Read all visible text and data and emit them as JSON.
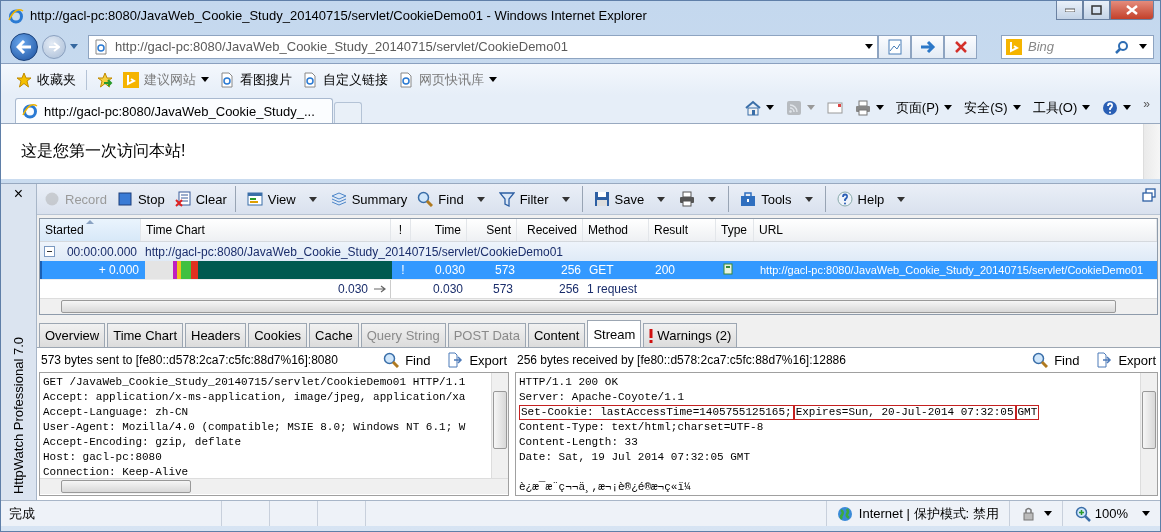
{
  "window": {
    "title": "http://gacl-pc:8080/JavaWeb_Cookie_Study_20140715/servlet/CookieDemo01 - Windows Internet Explorer"
  },
  "address_bar": {
    "value": "http://gacl-pc:8080/JavaWeb_Cookie_Study_20140715/servlet/CookieDemo01"
  },
  "search": {
    "placeholder": "Bing"
  },
  "favorites_bar": {
    "label": "收藏夹",
    "items": [
      {
        "label": "建议网站",
        "kind": "bing",
        "dropdown": true,
        "disabled": true
      },
      {
        "label": "看图搜片",
        "kind": "page",
        "dropdown": false,
        "disabled": false
      },
      {
        "label": "自定义链接",
        "kind": "page",
        "dropdown": false,
        "disabled": false
      },
      {
        "label": "网页快讯库",
        "kind": "page",
        "dropdown": true,
        "disabled": true
      }
    ]
  },
  "tabs": [
    {
      "label": "http://gacl-pc:8080/JavaWeb_Cookie_Study_...",
      "selected": true
    }
  ],
  "command_bar": {
    "more": "»",
    "items": [
      {
        "kind": "home",
        "dropdown": true,
        "disabled": false
      },
      {
        "kind": "feeds",
        "dropdown": true,
        "disabled": true
      },
      {
        "kind": "mail",
        "dropdown": false,
        "disabled": false
      },
      {
        "kind": "print",
        "dropdown": true,
        "disabled": false
      },
      {
        "kind": "menu",
        "label": "页面(P)",
        "dropdown": true,
        "disabled": false
      },
      {
        "kind": "menu",
        "label": "安全(S)",
        "dropdown": true,
        "disabled": false
      },
      {
        "kind": "menu",
        "label": "工具(O)",
        "dropdown": true,
        "disabled": false
      },
      {
        "kind": "help",
        "dropdown": true,
        "disabled": false
      }
    ]
  },
  "page": {
    "text": "这是您第一次访问本站!"
  },
  "httpwatch": {
    "title": "HttpWatch Professional 7.0",
    "close": "×",
    "toolbar": [
      {
        "kind": "record",
        "label": "Record",
        "dropdown": false,
        "disabled": true,
        "separator_after": false
      },
      {
        "kind": "stop",
        "label": "Stop",
        "dropdown": false,
        "disabled": false,
        "separator_after": false
      },
      {
        "kind": "clear",
        "label": "Clear",
        "dropdown": false,
        "disabled": false,
        "separator_after": true
      },
      {
        "kind": "view",
        "label": "View",
        "dropdown": true,
        "disabled": false,
        "separator_after": false
      },
      {
        "kind": "summary",
        "label": "Summary",
        "dropdown": false,
        "disabled": false,
        "separator_after": false
      },
      {
        "kind": "find",
        "label": "Find",
        "dropdown": true,
        "disabled": false,
        "separator_after": false
      },
      {
        "kind": "filter",
        "label": "Filter",
        "dropdown": true,
        "disabled": false,
        "separator_after": true
      },
      {
        "kind": "save",
        "label": "Save",
        "dropdown": true,
        "disabled": false,
        "separator_after": false
      },
      {
        "kind": "print",
        "dropdown": true,
        "disabled": false,
        "separator_after": true
      },
      {
        "kind": "tools",
        "label": "Tools",
        "dropdown": true,
        "disabled": false,
        "separator_after": true
      },
      {
        "kind": "help",
        "label": "Help",
        "dropdown": true,
        "disabled": false,
        "separator_after": false
      }
    ],
    "columns": [
      {
        "label": "Started",
        "sorted": true
      },
      {
        "label": "Time Chart",
        "sorted": false
      },
      {
        "label": "!",
        "sorted": false
      },
      {
        "label": "Time",
        "sorted": false
      },
      {
        "label": "Sent",
        "sorted": false
      },
      {
        "label": "Received",
        "sorted": false
      },
      {
        "label": "Method",
        "sorted": false
      },
      {
        "label": "Result",
        "sorted": false
      },
      {
        "label": "Type",
        "sorted": false
      },
      {
        "label": "URL",
        "sorted": false
      }
    ],
    "page_row": {
      "started": "00:00:00.000",
      "url": "http://gacl-pc:8080/JavaWeb_Cookie_Study_20140715/servlet/CookieDemo01",
      "expanded": true
    },
    "rows": [
      {
        "started": "+ 0.000",
        "warning": "!",
        "time": "0.030",
        "sent": "573",
        "received": "256",
        "method": "GET",
        "result": "200",
        "url": "http://gacl-pc:8080/JavaWeb_Cookie_Study_20140715/servlet/CookieDemo01",
        "selected": true
      }
    ],
    "totals": {
      "duration": "0.030",
      "time": "0.030",
      "sent": "573",
      "received": "256",
      "requests": "1 request"
    },
    "detail_tabs": [
      {
        "label": "Overview",
        "selected": false,
        "disabled": false,
        "warning": false
      },
      {
        "label": "Time Chart",
        "selected": false,
        "disabled": false,
        "warning": false
      },
      {
        "label": "Headers",
        "selected": false,
        "disabled": false,
        "warning": false
      },
      {
        "label": "Cookies",
        "selected": false,
        "disabled": false,
        "warning": false
      },
      {
        "label": "Cache",
        "selected": false,
        "disabled": false,
        "warning": false
      },
      {
        "label": "Query String",
        "selected": false,
        "disabled": true,
        "warning": false
      },
      {
        "label": "POST Data",
        "selected": false,
        "disabled": true,
        "warning": false
      },
      {
        "label": "Content",
        "selected": false,
        "disabled": false,
        "warning": false
      },
      {
        "label": "Stream",
        "selected": true,
        "disabled": false,
        "warning": false
      },
      {
        "label": "Warnings (2)",
        "selected": false,
        "disabled": false,
        "warning": true
      }
    ],
    "request": {
      "summary": "573 bytes sent to [fe80::d578:2ca7:c5fc:88d7%16]:8080",
      "find": "Find",
      "export": "Export",
      "lines": [
        {
          "parts": [
            "GET /JavaWeb_Cookie_Study_20140715/servlet/CookieDemo01 HTTP/1.1"
          ],
          "boxed": false,
          "blank_before": false
        },
        {
          "parts": [
            "Accept: application/x-ms-application, image/jpeg, application/xa"
          ],
          "boxed": false,
          "blank_before": false
        },
        {
          "parts": [
            "Accept-Language: zh-CN"
          ],
          "boxed": false,
          "blank_before": false
        },
        {
          "parts": [
            "User-Agent: Mozilla/4.0 (compatible; MSIE 8.0; Windows NT 6.1; W"
          ],
          "boxed": false,
          "blank_before": false
        },
        {
          "parts": [
            "Accept-Encoding: gzip, deflate"
          ],
          "boxed": false,
          "blank_before": false
        },
        {
          "parts": [
            "Host: gacl-pc:8080"
          ],
          "boxed": false,
          "blank_before": false
        },
        {
          "parts": [
            "Connection: Keep-Alive"
          ],
          "boxed": false,
          "blank_before": false
        }
      ]
    },
    "response": {
      "summary": "256 bytes received by [fe80::d578:2ca7:c5fc:88d7%16]:12886",
      "find": "Find",
      "export": "Export",
      "lines": [
        {
          "parts": [
            "HTTP/1.1 200 OK"
          ],
          "boxed": false,
          "blank_before": false
        },
        {
          "parts": [
            "Server: Apache-Coyote/1.1"
          ],
          "boxed": false,
          "blank_before": false
        },
        {
          "parts": [
            "Set-Cookie: lastAccessTime=1405755125165;",
            "Expires=Sun, 20-Jul-2014 07:32:05",
            "GMT"
          ],
          "boxed": true,
          "blank_before": false
        },
        {
          "parts": [
            "Content-Type: text/html;charset=UTF-8"
          ],
          "boxed": false,
          "blank_before": false
        },
        {
          "parts": [
            "Content-Length: 33"
          ],
          "boxed": false,
          "blank_before": false
        },
        {
          "parts": [
            "Date: Sat, 19 Jul 2014 07:32:05 GMT"
          ],
          "boxed": false,
          "blank_before": false
        },
        {
          "parts": [
            "è¿æ¯æ¨ç¬¬ä¸,æ¬¡è®¿é®æ¬ç«ï¼"
          ],
          "boxed": false,
          "blank_before": true
        }
      ]
    }
  },
  "status_bar": {
    "text": "完成",
    "zone": "Internet | 保护模式: 禁用",
    "zoom": "100%"
  }
}
